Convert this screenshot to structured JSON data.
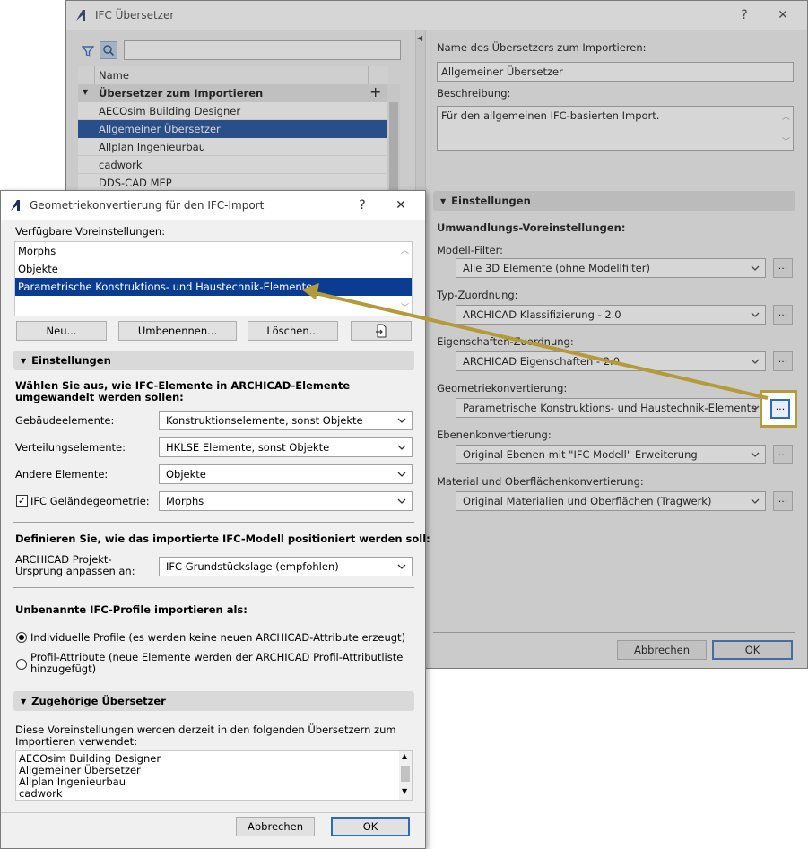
{
  "ifc_window": {
    "title": "IFC Übersetzer",
    "help": "?",
    "close": "✕",
    "search_placeholder": "",
    "list_header": "Name",
    "group_label": "Übersetzer zum Importieren",
    "add_symbol": "+",
    "items": [
      "AECOsim Building Designer",
      "Allgemeiner Übersetzer",
      "Allplan Ingenieurbau",
      "cadwork",
      "DDS-CAD MEP"
    ],
    "selected_index": 1,
    "name_label": "Name des Übersetzers zum Importieren:",
    "name_value": "Allgemeiner Übersetzer",
    "desc_label": "Beschreibung:",
    "desc_value": "Für den allgemeinen IFC-basierten Import.",
    "settings_section": "Einstellungen",
    "conversion_heading": "Umwandlungs-Voreinstellungen:",
    "fields": [
      {
        "label": "Modell-Filter:",
        "value": "Alle 3D Elemente (ohne Modellfilter)"
      },
      {
        "label": "Typ-Zuordnung:",
        "value": "ARCHICAD Klassifizierung - 2.0"
      },
      {
        "label": "Eigenschaften-Zuordnung:",
        "value": "ARCHICAD Eigenschaften - 2.0"
      },
      {
        "label": "Geometriekonvertierung:",
        "value": "Parametrische Konstruktions- und Haustechnik-Elemente"
      },
      {
        "label": "Ebenenkonvertierung:",
        "value": "Original Ebenen mit \"IFC Modell\" Erweiterung"
      },
      {
        "label": "Material und Oberflächenkonvertierung:",
        "value": "Original Materialien und Oberflächen (Tragwerk)"
      }
    ],
    "dots_label": "...",
    "cancel": "Abbrechen",
    "ok": "OK"
  },
  "geo_window": {
    "title": "Geometriekonvertierung für den IFC-Import",
    "help": "?",
    "close": "✕",
    "presets_label": "Verfügbare Voreinstellungen:",
    "presets": [
      "Morphs",
      "Objekte",
      "Parametrische Konstruktions- und Haustechnik-Elemente"
    ],
    "selected_preset": 2,
    "btn_new": "Neu...",
    "btn_rename": "Umbenennen...",
    "btn_delete": "Löschen...",
    "settings_section": "Einstellungen",
    "choose_heading": "Wählen Sie aus, wie IFC-Elemente in ARCHICAD-Elemente umgewandelt werden sollen:",
    "rows": [
      {
        "label": "Gebäudeelemente:",
        "value": "Konstruktionselemente, sonst Objekte"
      },
      {
        "label": "Verteilungselemente:",
        "value": "HKLSE Elemente, sonst Objekte"
      },
      {
        "label": "Andere Elemente:",
        "value": "Objekte"
      },
      {
        "label": "IFC Geländegeometrie:",
        "value": "Morphs"
      }
    ],
    "terrain_checked": true,
    "position_heading": "Definieren Sie, wie das importierte IFC-Modell positioniert werden soll:",
    "origin_label": "ARCHICAD Projekt-Ursprung anpassen an:",
    "origin_value": "IFC Grundstückslage (empfohlen)",
    "profiles_heading": "Unbenannte IFC-Profile importieren als:",
    "radio1": "Individuelle Profile (es werden keine neuen ARCHICAD-Attribute erzeugt)",
    "radio2": "Profil-Attribute (neue Elemente werden der ARCHICAD Profil-Attributliste hinzugefügt)",
    "radio_selected": 1,
    "related_section": "Zugehörige Übersetzer",
    "related_text": "Diese Voreinstellungen werden derzeit in den folgenden Übersetzern zum Importieren verwendet:",
    "related_list": [
      "AECOsim Building Designer",
      "Allgemeiner Übersetzer",
      "Allplan Ingenieurbau",
      "cadwork"
    ],
    "cancel": "Abbrechen",
    "ok": "OK"
  },
  "colors": {
    "selection": "#0a3d91",
    "highlight_box": "#b59a3a",
    "arrow": "#b59a3a",
    "default_button": "#2b6bb8"
  }
}
